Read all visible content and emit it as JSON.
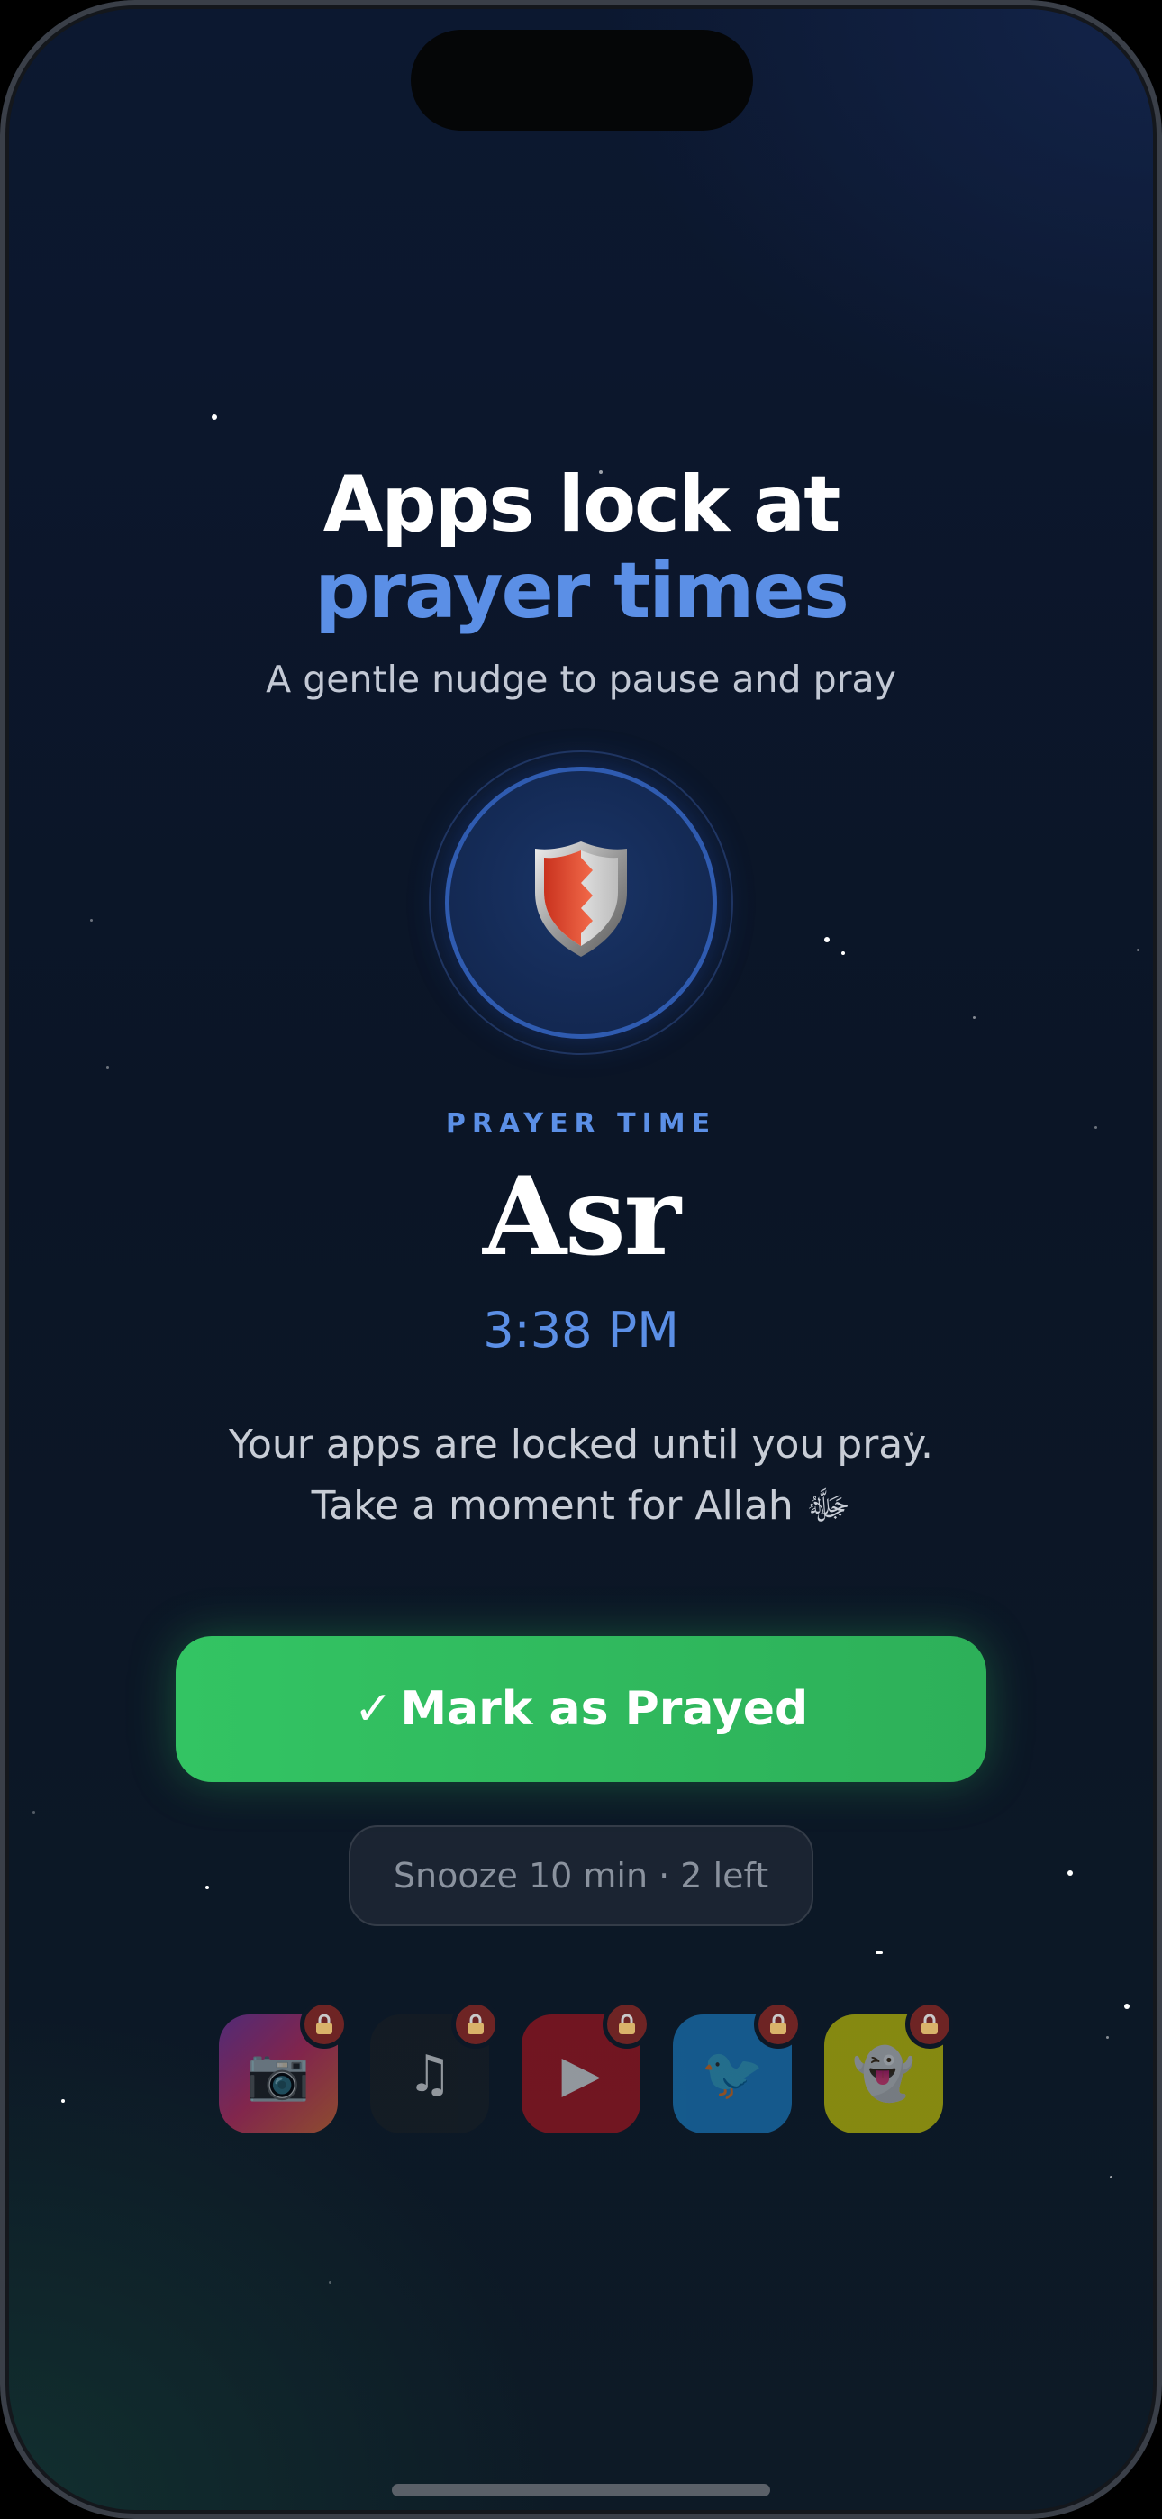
{
  "header": {
    "title_line1": "Apps lock at",
    "title_line2": "prayer times",
    "subtitle": "A gentle nudge to pause and pray"
  },
  "badge": {
    "icon": "shield-icon"
  },
  "prayer": {
    "label": "PRAYER TIME",
    "name": "Asr",
    "time": "3:38 PM"
  },
  "message": {
    "line1": "Your apps are locked until you pray.",
    "line2": "Take a moment for Allah ﷻ"
  },
  "actions": {
    "mark_prayed_check": "✓",
    "mark_prayed_label": "Mark as Prayed",
    "snooze_label": "Snooze 10 min · 2 left"
  },
  "locked_apps": [
    {
      "icon": "camera-icon",
      "glyph": "📷",
      "color": "#c8375a"
    },
    {
      "icon": "music-icon",
      "glyph": "♫",
      "color": "#1a1f24"
    },
    {
      "icon": "play-icon",
      "glyph": "▶",
      "color": "#c4141e"
    },
    {
      "icon": "bird-icon",
      "glyph": "🐦",
      "color": "#1d8fe0"
    },
    {
      "icon": "ghost-icon",
      "glyph": "👻",
      "color": "#e9e600"
    }
  ],
  "colors": {
    "accent_blue": "#5b8fe6",
    "primary_green": "#33c463",
    "background": "#0b1526"
  }
}
